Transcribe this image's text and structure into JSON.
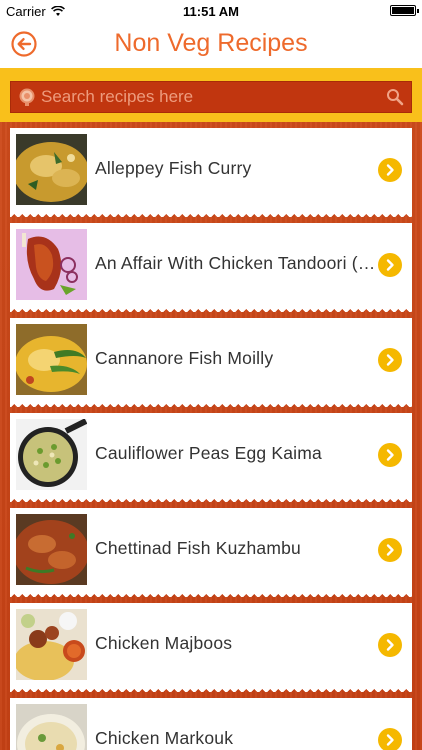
{
  "status_bar": {
    "carrier": "Carrier",
    "time": "11:51 AM",
    "icons": [
      "wifi-icon",
      "battery-icon"
    ]
  },
  "nav": {
    "title": "Non Veg Recipes",
    "back_icon": "back-arrow-icon"
  },
  "search": {
    "placeholder": "Search recipes here",
    "value": "",
    "icons": [
      "app-logo-icon",
      "search-icon"
    ]
  },
  "recipes": [
    {
      "title": "Alleppey Fish Curry"
    },
    {
      "title": "An Affair With Chicken Tandoori (T..."
    },
    {
      "title": "Cannanore Fish Moilly"
    },
    {
      "title": "Cauliflower Peas Egg Kaima"
    },
    {
      "title": "Chettinad Fish Kuzhambu"
    },
    {
      "title": "Chicken Majboos"
    },
    {
      "title": "Chicken Markouk"
    }
  ],
  "colors": {
    "accent_orange": "#ee6a2c",
    "band_yellow": "#f9c01b",
    "search_red": "#c1360f",
    "chevron_yellow": "#f5b800",
    "background_red": "#c9471a"
  }
}
